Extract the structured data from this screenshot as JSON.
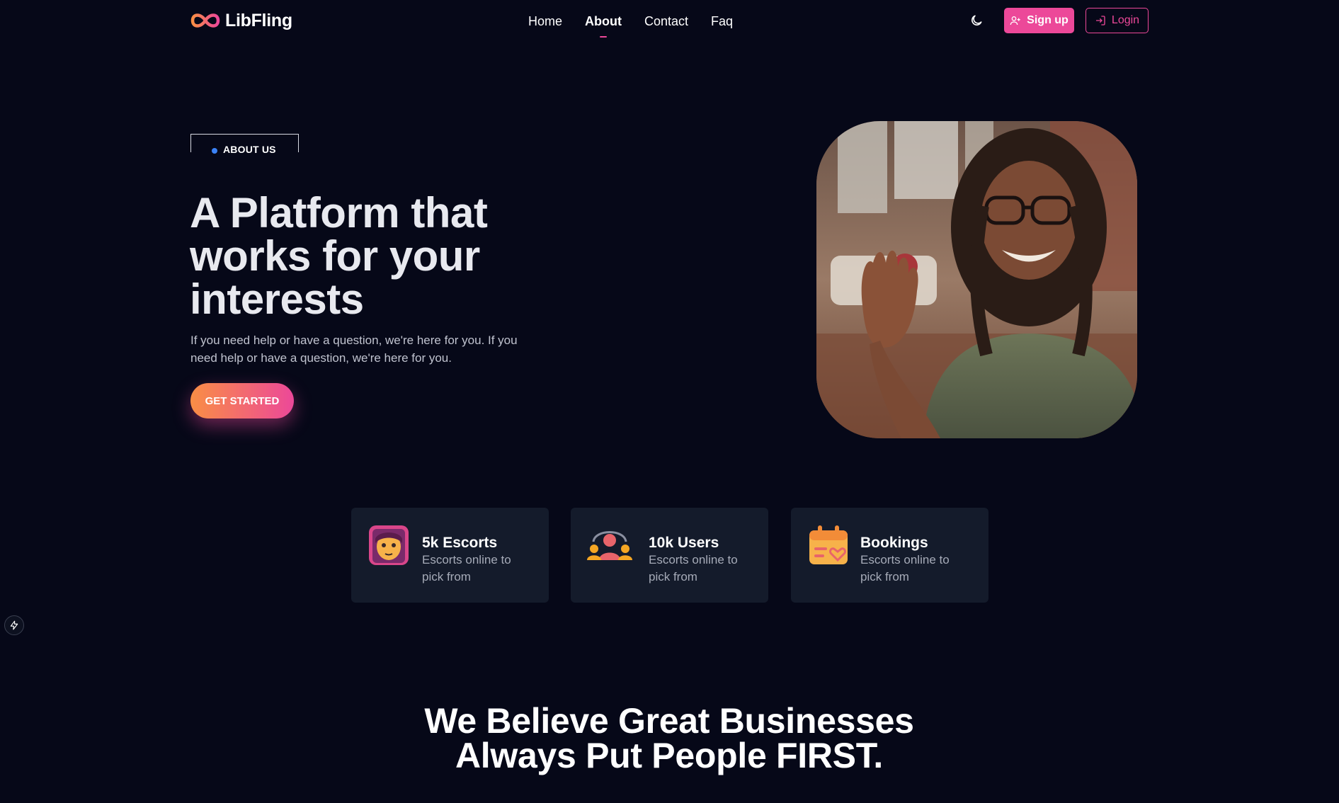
{
  "nav": {
    "logo_text": "LibFling",
    "links": [
      {
        "label": "Home"
      },
      {
        "label": "About"
      },
      {
        "label": "Contact"
      },
      {
        "label": "Faq"
      }
    ],
    "active_link": "About",
    "theme_toggle_icon": "moon-icon",
    "signup_label": "Sign up",
    "login_label": "Login"
  },
  "hero": {
    "badge": "ABOUT US",
    "title": "A Platform that works for your interests",
    "description": "If you need help or have a question, we're here for you. If you need help or have a question, we're here for you.",
    "cta_label": "GET STARTED"
  },
  "stats": [
    {
      "icon": "escort-avatar-icon",
      "title": "5k Escorts",
      "subtitle": "Escorts online to pick from"
    },
    {
      "icon": "users-group-icon",
      "title": "10k Users",
      "subtitle": "Escorts online to pick from"
    },
    {
      "icon": "calendar-heart-icon",
      "title": "Bookings",
      "subtitle": "Escorts online to pick from"
    }
  ],
  "section": {
    "title": "We Believe Great Businesses Always Put People FIRST."
  },
  "colors": {
    "background": "#060818",
    "accent_pink": "#ec4899",
    "accent_orange": "#f98e45",
    "card": "#141b2b",
    "badge_dot": "#3b82f6"
  }
}
